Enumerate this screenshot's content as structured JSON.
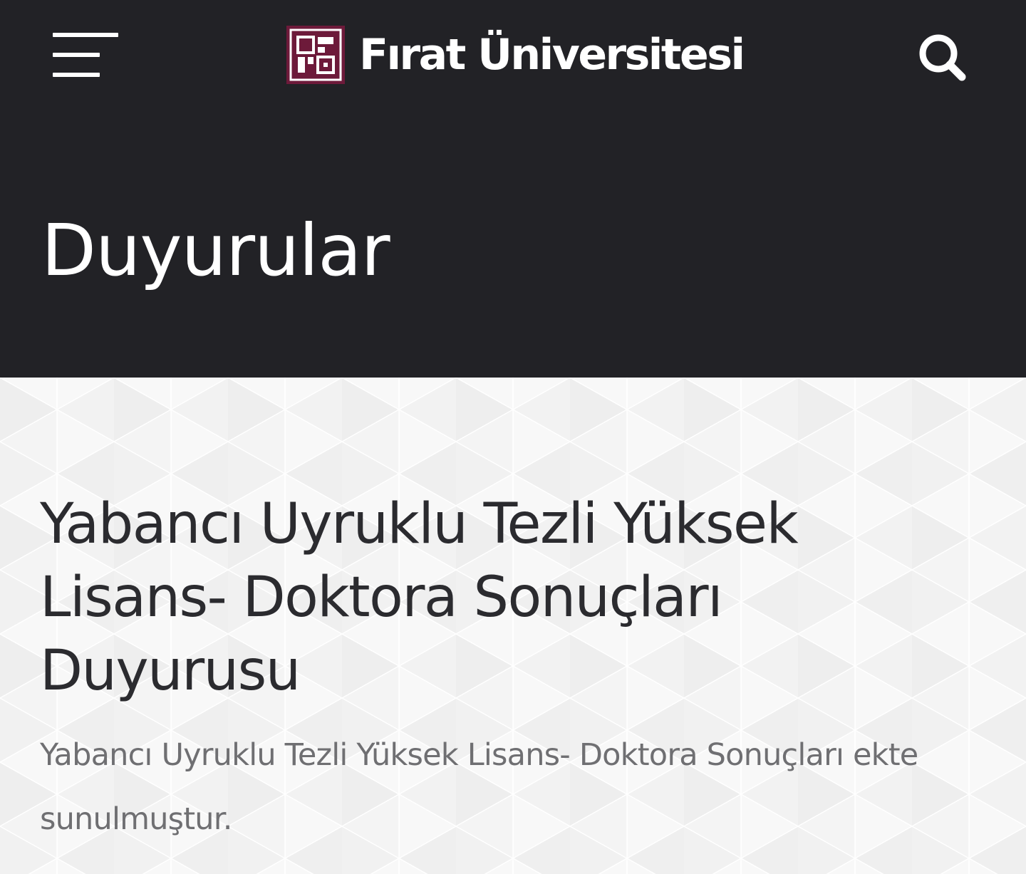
{
  "header": {
    "logo_text": "Fırat Üniversitesi",
    "logo_color": "#6d1a3a",
    "background_color": "#222226",
    "menu_icon": "hamburger-menu-icon",
    "search_icon": "search-icon"
  },
  "page": {
    "title": "Duyurular"
  },
  "article": {
    "title": "Yabancı Uyruklu Tezli Yüksek Lisans- Doktora Sonuçları Duyurusu",
    "body": "Yabancı Uyruklu Tezli Yüksek Lisans- Doktora Sonuçları ekte sunulmuştur."
  }
}
